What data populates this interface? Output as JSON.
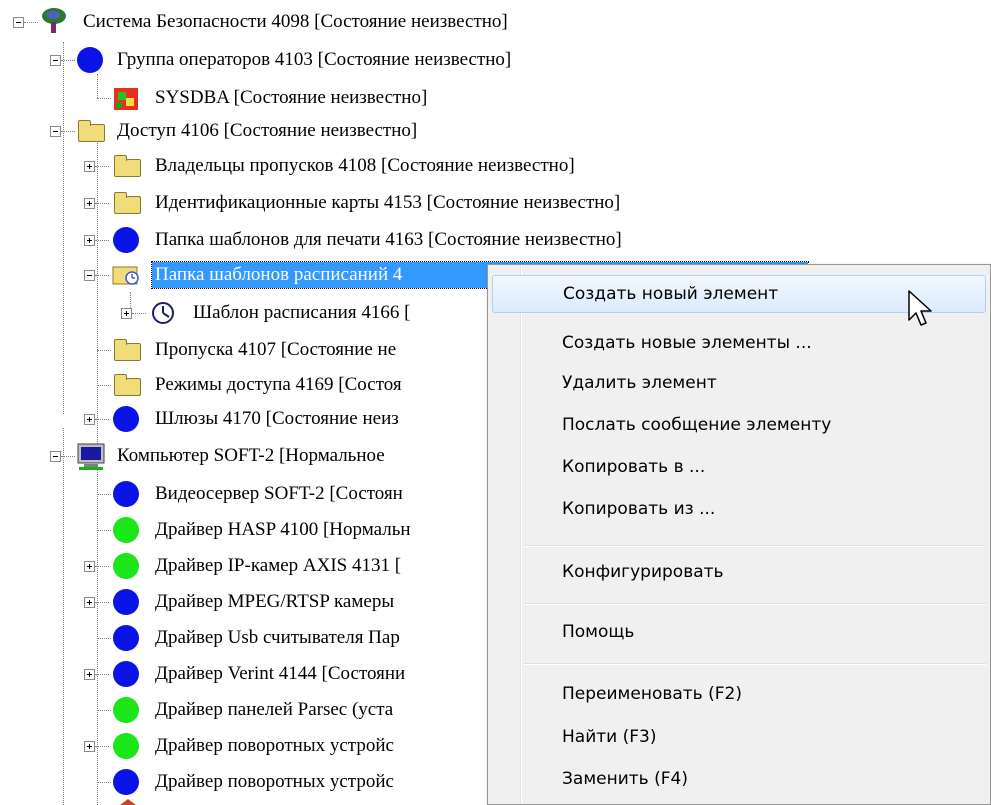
{
  "tree": {
    "items": [
      {
        "label": "Система Безопасности 4098 [Состояние неизвестно]",
        "icon": "security-system-icon"
      },
      {
        "label": "Группа операторов 4103 [Состояние неизвестно]",
        "icon": "blue-circle-icon"
      },
      {
        "label": "SYSDBA [Состояние неизвестно]",
        "icon": "user-icon"
      },
      {
        "label": "Доступ 4106 [Состояние неизвестно]",
        "icon": "folder-icon"
      },
      {
        "label": "Владельцы пропусков 4108 [Состояние неизвестно]",
        "icon": "folder-icon"
      },
      {
        "label": "Идентификационные карты 4153 [Состояние неизвестно]",
        "icon": "folder-icon"
      },
      {
        "label": "Папка шаблонов для печати 4163 [Состояние неизвестно]",
        "icon": "blue-circle-icon"
      },
      {
        "label": "Папка шаблонов расписаний 4",
        "icon": "schedule-folder-icon"
      },
      {
        "label": "Шаблон расписания 4166 [",
        "icon": "clock-icon"
      },
      {
        "label": "Пропуска 4107 [Состояние не",
        "icon": "folder-icon"
      },
      {
        "label": "Режимы доступа 4169 [Состоя",
        "icon": "folder-icon"
      },
      {
        "label": "Шлюзы 4170 [Состояние неиз",
        "icon": "blue-circle-icon"
      },
      {
        "label": "Компьютер SOFT-2 [Нормальное",
        "icon": "computer-icon"
      },
      {
        "label": "Видеосервер SOFT-2 [Состоян",
        "icon": "blue-circle-icon"
      },
      {
        "label": "Драйвер HASP 4100 [Нормальн",
        "icon": "green-circle-icon"
      },
      {
        "label": "Драйвер IP-камер AXIS 4131 [",
        "icon": "green-circle-icon"
      },
      {
        "label": "Драйвер MPEG/RTSP камеры",
        "icon": "blue-circle-icon"
      },
      {
        "label": "Драйвер Usb считывателя Пар",
        "icon": "blue-circle-icon"
      },
      {
        "label": "Драйвер Verint 4144 [Состояни",
        "icon": "blue-circle-icon"
      },
      {
        "label": "Драйвер панелей Parsec (уста",
        "icon": "green-circle-icon"
      },
      {
        "label": "Драйвер поворотных устройс",
        "icon": "green-circle-icon"
      },
      {
        "label": "Драйвер поворотных устройс",
        "icon": "blue-circle-icon"
      }
    ]
  },
  "context_menu": {
    "items": [
      {
        "label": "Создать новый элемент"
      },
      {
        "label": "Создать новые элементы ..."
      },
      {
        "label": "Удалить элемент"
      },
      {
        "label": "Послать сообщение элементу"
      },
      {
        "label": "Копировать в ..."
      },
      {
        "label": "Копировать из ..."
      },
      {
        "label": "Конфигурировать"
      },
      {
        "label": "Помощь"
      },
      {
        "label": "Переименовать (F2)"
      },
      {
        "label": "Найти (F3)"
      },
      {
        "label": "Заменить (F4)"
      }
    ]
  },
  "colors": {
    "selection": "#3399ff",
    "blue_status": "#0a14e6",
    "green_status": "#1ae61a",
    "folder": "#f1dc7a"
  }
}
